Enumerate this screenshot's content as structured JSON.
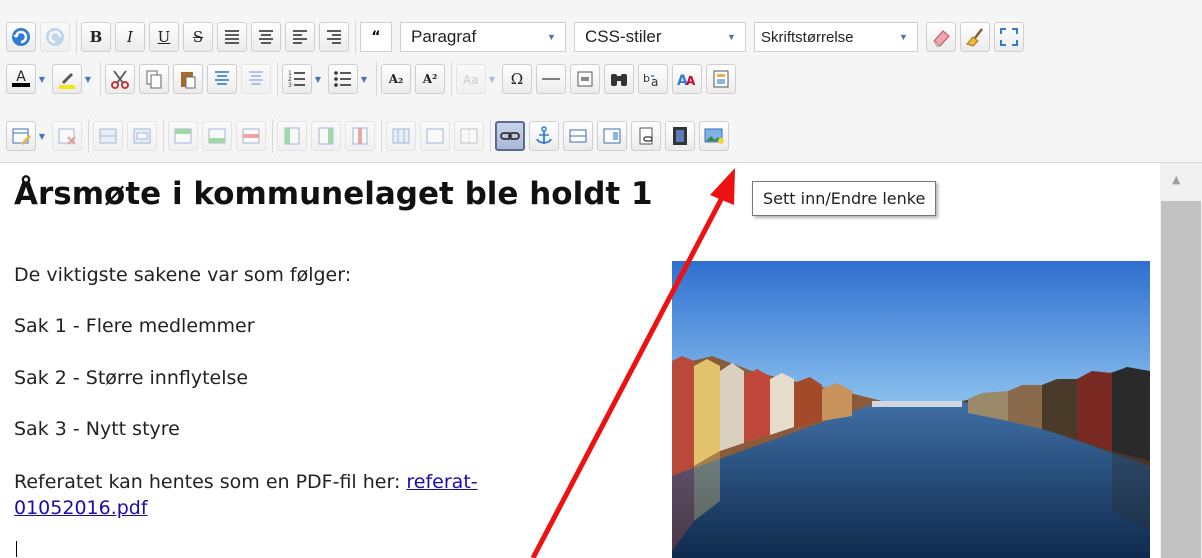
{
  "toolbar": {
    "format_select": "Paragraf",
    "styles_select": "CSS-stiler",
    "fontsize_select": "Skriftstørrelse",
    "bold_label": "B",
    "italic_label": "I",
    "underline_label": "U",
    "strike_label": "S",
    "quote_label": "“",
    "subscript_label": "A₂",
    "superscript_label": "A²",
    "omega_label": "Ω",
    "hovered_button": "insert-link-button"
  },
  "tooltip": {
    "text": "Sett inn/Endre lenke"
  },
  "editor": {
    "heading": "Årsmøte i kommunelaget ble holdt 1",
    "intro": "De viktigste sakene var som følger:",
    "items": [
      "Sak 1 - Flere medlemmer",
      "Sak 2 - Større innflytelse",
      "Sak 3 - Nytt styre"
    ],
    "referat_text": "Referatet kan hentes som en PDF-fil her: ",
    "referat_link_line1": "referat-",
    "referat_link_line2": "01052016.pdf"
  },
  "colors": {
    "annotation_arrow": "#ee1111",
    "link": "#1a0dab",
    "hover_button": "#aab8d8"
  }
}
